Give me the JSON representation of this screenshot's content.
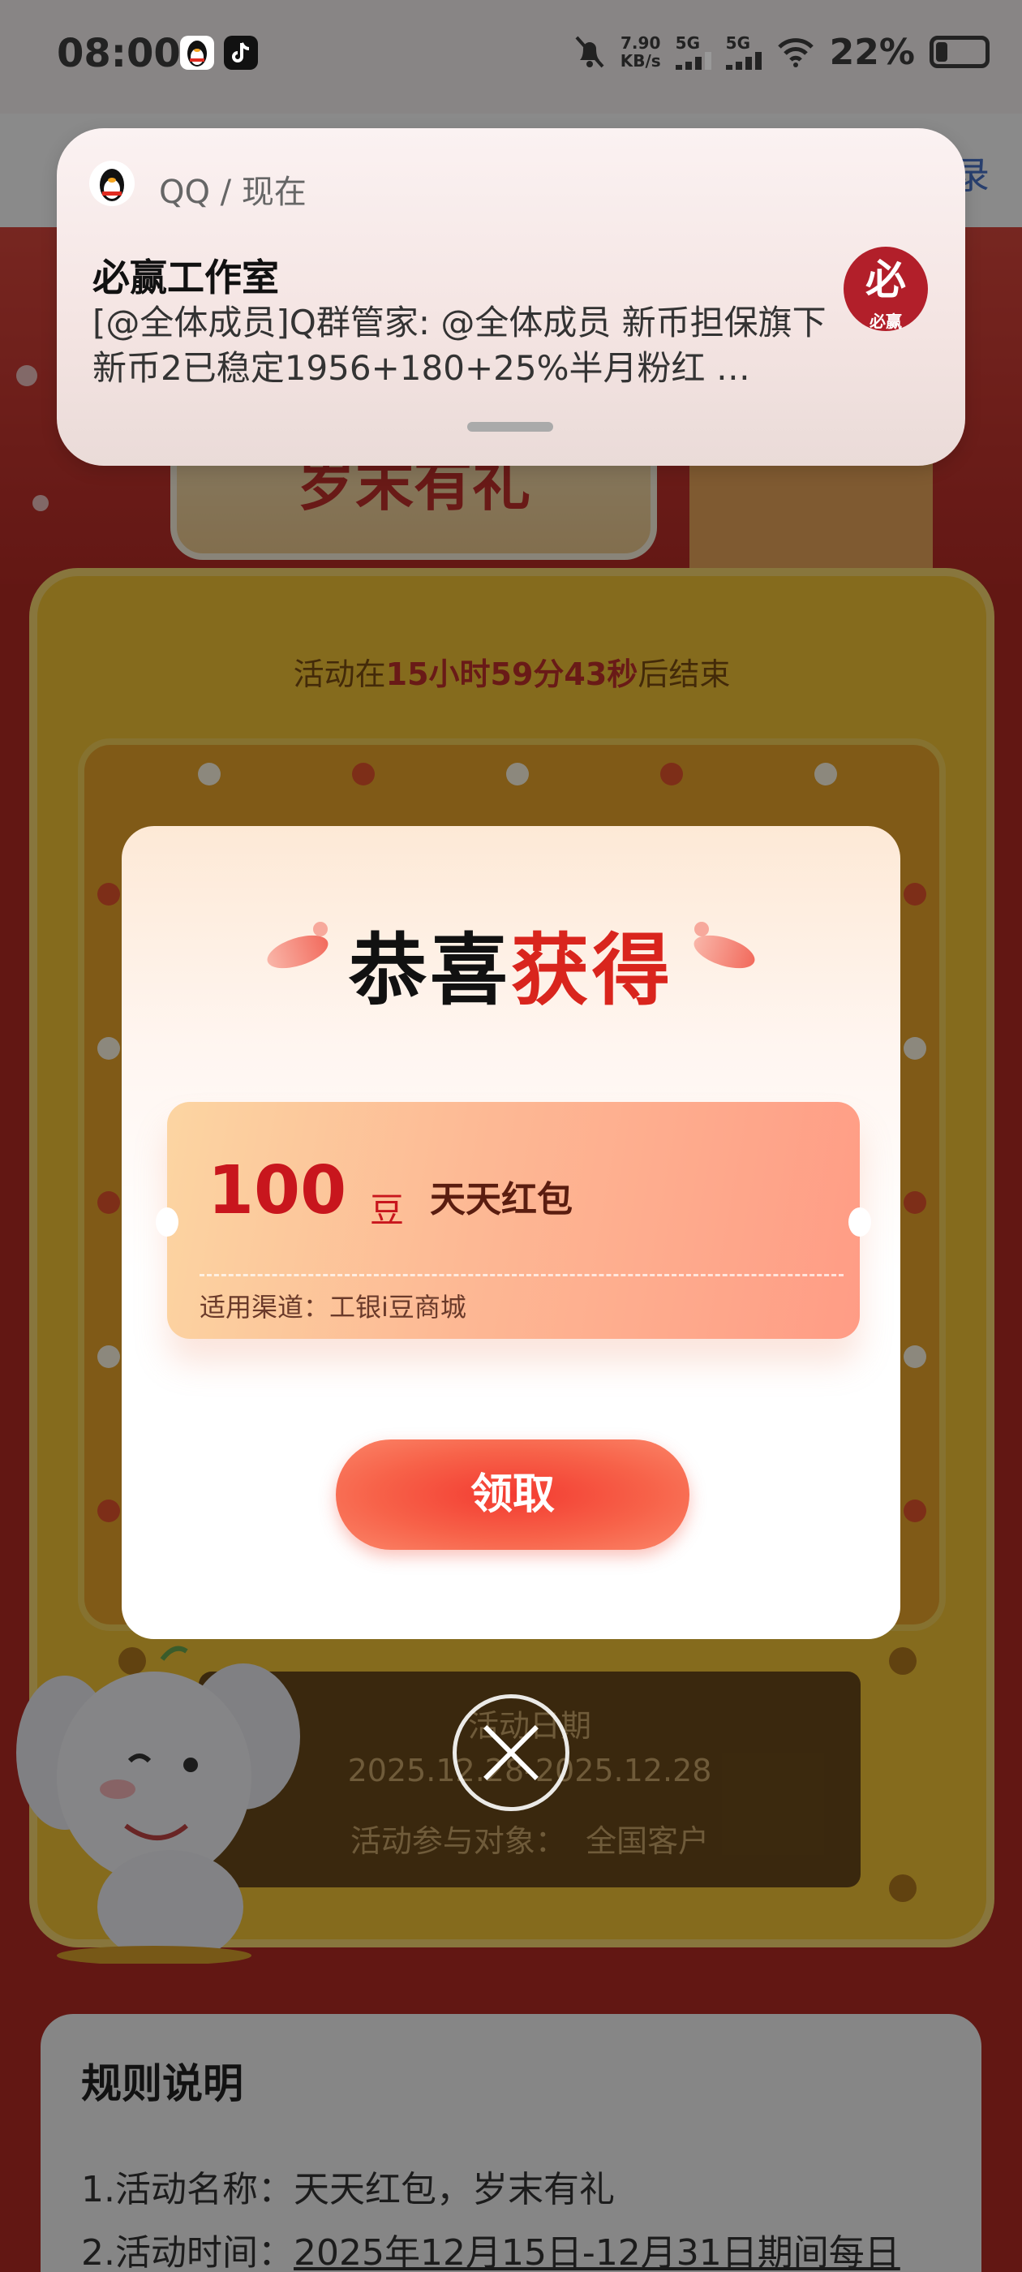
{
  "status_bar": {
    "time": "08:00",
    "net_speed_value": "7.90",
    "net_speed_unit": "KB/s",
    "signal1_label": "5G",
    "signal2_label": "5G",
    "battery_percent": "22%"
  },
  "topbar": {
    "right_text": "录"
  },
  "notification": {
    "app": "QQ / 现在",
    "title": "必赢工作室",
    "body": "[@全体成员]Q群管家: @全体成员 新币担保旗下新币2已稳定1956+180+25%半月粉红 …",
    "avatar_big": "必",
    "avatar_small": "必赢"
  },
  "background": {
    "hero_title": "岁末有礼",
    "countdown_prefix": "活动在",
    "countdown_value": "15小时59分43秒",
    "countdown_suffix": "后结束",
    "info_title": "活动日期",
    "info_dates": "2025.12.28-2025.12.28",
    "info_target_label": "活动参与对象：",
    "info_target_value": "全国客户"
  },
  "rules": {
    "title": "规则说明",
    "line1": "1.活动名称：天天红包，岁末有礼",
    "line2_prefix": "2.活动时间：",
    "line2_value": "2025年12月15日-12月31日期间每日"
  },
  "modal": {
    "title_black": "恭喜",
    "title_red": "获得",
    "coupon_amount": "100",
    "coupon_unit": "豆",
    "coupon_name": "天天红包",
    "coupon_channel": "适用渠道：工银i豆商城",
    "claim_label": "领取"
  },
  "colors": {
    "accent_red": "#d9251d",
    "gold": "#f3c336",
    "coupon_peach": "#fdb894"
  }
}
